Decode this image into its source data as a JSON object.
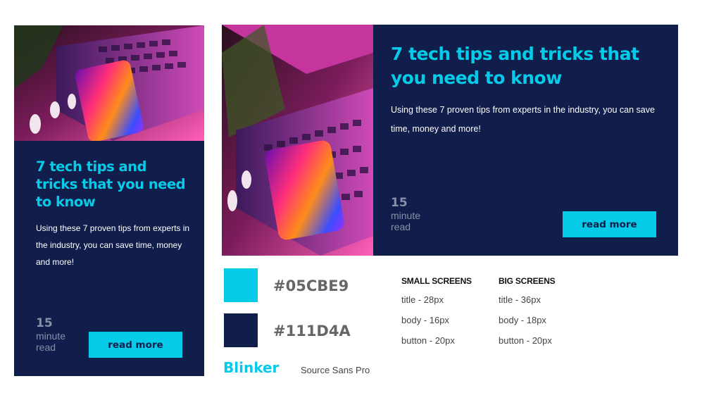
{
  "colors": {
    "accent": "#05CBE9",
    "navy": "#111D4A"
  },
  "small_card": {
    "title": "7 tech tips and tricks that you need to know",
    "body": "Using these 7 proven tips from experts in the industry, you can save time, money and more!",
    "minutes_number": "15",
    "minutes_label": "minute read",
    "button_label": "read more",
    "image_icon": "laptop-phone-photo"
  },
  "big_card": {
    "title": "7 tech tips and tricks that you need to know",
    "body": "Using these 7 proven tips from experts in the industry, you can save time, money and more!",
    "minutes_number": "15",
    "minutes_label": "minute read",
    "button_label": "read more",
    "image_icon": "laptop-phone-photo"
  },
  "palette": {
    "primary_hex": "#05CBE9",
    "secondary_hex": "#111D4A"
  },
  "fonts": {
    "heading_font_label": "Blinker",
    "body_font_label": "Source Sans Pro"
  },
  "specs": {
    "small": {
      "heading": "SMALL SCREENS",
      "rows": [
        "title - 28px",
        "body - 16px",
        "button - 20px"
      ]
    },
    "big": {
      "heading": "BIG SCREENS",
      "rows": [
        "title - 36px",
        "body - 18px",
        "button - 20px"
      ]
    }
  }
}
